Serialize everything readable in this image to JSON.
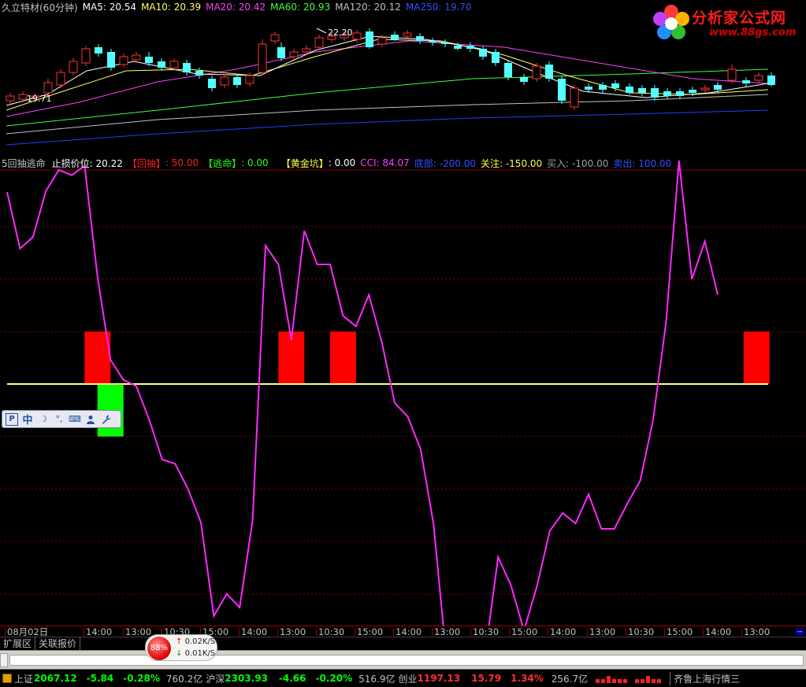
{
  "top_info": {
    "stock": "久立特材(60分钟)",
    "ma5_label": "MA5: 20.54",
    "ma10_label": "MA10: 20.39",
    "ma20_label": "MA20: 20.42",
    "ma60_label": "MA60: 20.93",
    "ma120_label": "MA120: 20.12",
    "ma250_label": "MA250: 19.70"
  },
  "logo": {
    "text": "分析家公式网",
    "url": "www.88gs.com"
  },
  "price_annotations": {
    "high": "22.20",
    "low": "19.71"
  },
  "indicator_info": {
    "name": "5回抽逃命",
    "stop_label": "止损价位: 20.22",
    "huichou_name": "【回抽】",
    "huichou_value": ": 50.00",
    "taoming_name": "【逃命】",
    "taoming_value": ": 0.00",
    "huangjin_name": "【黄金坑】",
    "huangjin_value": ": 0.00",
    "cci": "CCI: 84.07",
    "dibu": "底部: -200.00",
    "guanzhu": "关注: -150.00",
    "mairu": "买入: -100.00",
    "maichu": "卖出: 100.00"
  },
  "colors": {
    "cci_line": "#ff28ff",
    "huichou_bar": "#ff0000",
    "taoming_bar": "#00ff00",
    "zero_line": "#ffff80",
    "up_candle": "#ff3232",
    "down_candle": "#54ffff",
    "grid": "#800000"
  },
  "floating_toolbar": {
    "ime_icon": "P",
    "lang": "中",
    "moon_icon": "☽",
    "punct_icon": "°,",
    "keyboard_icon": "⌨",
    "user_icon": "👤",
    "wrench_icon": "🔧"
  },
  "time_axis": {
    "labels": [
      "08月02日",
      "14:00",
      "13:00",
      "10:30",
      "15:00",
      "14:00",
      "13:00",
      "10:30",
      "15:00",
      "14:00",
      "13:00",
      "10:30",
      "15:00",
      "14:00",
      "13:00",
      "10:30",
      "15:00",
      "14:00",
      "13:00"
    ],
    "end_marker": "--"
  },
  "tabs": [
    "扩展区",
    "关联报价"
  ],
  "speed": {
    "percent": "88%",
    "up": "0.02K/S",
    "down": "0.01K/S"
  },
  "status": {
    "sh_name": "上证",
    "sh_index": "2067.12",
    "sh_change": "-5.84",
    "sh_pct": "-0.28%",
    "sh_amount": "760.2亿",
    "hs_name": "沪深",
    "hs_index": "2303.93",
    "hs_change": "-4.66",
    "hs_pct": "-0.20%",
    "hs_amount": "516.9亿",
    "cy_name": "创业",
    "cy_index": "1197.13",
    "cy_change": "15.79",
    "cy_pct": "1.34%",
    "cy_amount": "256.7亿",
    "ticker": "齐鲁上海行情三"
  },
  "chart_data": {
    "type": "line",
    "title": "5回抽逃命",
    "series": [
      {
        "name": "CCI",
        "values": [
          183,
          129,
          140,
          184,
          204,
          199,
          208,
          102,
          23,
          4,
          -2,
          -34,
          -72,
          -76,
          -100,
          -132,
          -221,
          -200,
          -213,
          -130,
          132,
          114,
          42,
          146,
          114,
          114,
          65,
          55,
          85,
          40,
          -18,
          -31,
          -62,
          -133,
          -261,
          -269,
          -290,
          -257,
          -165,
          -192,
          -235,
          -193,
          -140,
          -123,
          -133,
          -105,
          -138,
          -138,
          -114,
          -92,
          -34,
          59,
          213,
          100,
          136,
          85
        ]
      }
    ],
    "bars": [
      {
        "name": "回抽",
        "index": 7,
        "value": 50
      },
      {
        "name": "逃命",
        "index": 8,
        "value": -50
      },
      {
        "name": "回抽",
        "index": 22,
        "value": 50
      },
      {
        "name": "回抽",
        "index": 26,
        "value": 50
      },
      {
        "name": "回抽",
        "index": 58,
        "value": 50
      }
    ],
    "reference_lines": [
      0
    ],
    "ylim": [
      -300,
      225
    ]
  }
}
